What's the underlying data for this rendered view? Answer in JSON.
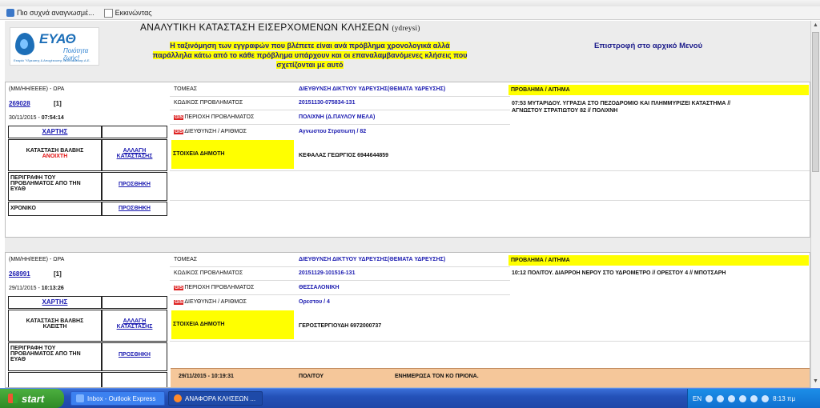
{
  "favorites": {
    "item1": "Πιο συχνά αναγνωσμέ...",
    "item2": "Εκκινώντας"
  },
  "header": {
    "logo_text": "ΕΥΑΘ",
    "logo_slogan": "Ποιότητα ζωής!",
    "logo_small": "Εταιρία Ύδρευσης & Αποχέτευσης Θεσσαλονίκης Α.Ε.",
    "title": "ΑΝΑΛΥΤΙΚΗ ΚΑΤΑΣΤΑΣΗ ΕΙΣΕΡΧΟΜΕΝΩΝ ΚΛΗΣΕΩΝ",
    "title_code": "(ydreysi)",
    "notice_line1": "Η ταξινόμηση των εγγραφών που βλέπετε είναι ανά πρόβλημα χρονολογικά αλλά",
    "notice_line2": "παράλληλα κάτω από το κάθε πρόβλημα υπάρχουν και οι επαναλαμβανόμενες κλήσεις που",
    "notice_line3": "σχετίζονται με αυτό",
    "back_link": "Επιστροφή στο αρχικό Μενού"
  },
  "labels": {
    "datetime": "(ΜΜ/ΗΗ/ΕΕΕΕ) - ΩΡΑ",
    "sector": "ΤΟΜΕΑΣ",
    "problem_code": "ΚΩΔΙΚΟΣ ΠΡΟΒΛΗΜΑΤΟΣ",
    "gis": "GIS",
    "area": "ΠΕΡΙΟΧΗ ΠΡΟΒΛΗΜΑΤΟΣ",
    "address": "ΔΙΕΥΘΥΝΣΗ / ΑΡΙΘΜΟΣ",
    "citizen": "ΣΤΟΙΧΕΙΑ ΔΗΜΟΤΗ",
    "problem_request": "ΠΡΟΒΛΗΜΑ / ΑΙΤΗΜΑ",
    "map": "ΧΑΡΤΗΣ",
    "valve_state": "ΚΑΤΑΣΤΑΣΗ ΒΑΛΒΗΣ",
    "change_state_1": "ΑΛΛΑΓΗ",
    "change_state_2": "ΚΑΤΑΣΤΑΣΗΣ",
    "description_1": "ΠΕΡΙΓΡΑΦΗ ΤΟΥ",
    "description_2": "ΠΡΟΒΛΗΜΑΤΟΣ ΑΠΟ ΤΗΝ",
    "description_3": "ΕΥΑΘ",
    "add": "ΠΡΟΣΘΗΚΗ",
    "chronicle": "ΧΡΟΝΙΚΟ"
  },
  "records": [
    {
      "id": "269028",
      "count": "[1]",
      "date": "30/11/2015 - ",
      "time": "07:54:14",
      "sector": "ΔΙΕΥΘΥΝΣΗ ΔΙΚΤΥΟΥ ΥΔΡΕΥΣΗΣ(ΘΕΜΑΤΑ ΥΔΡΕΥΣΗΣ)",
      "problem_code": "20151130-075834-131",
      "area": "ΠΟΛΙΧΝΗ (Δ.ΠΑΥΛΟΥ ΜΕΛΑ)",
      "address": "Αγνωστου Στρατιωτη / 82",
      "citizen": "ΚΕΦΑΛΑΣ ΓΕΩΡΓΙΟΣ 6944644859",
      "valve_state": "ΑΝΟΙΧΤΗ",
      "problem_text_1": "07:53 ΜΥΤΑΡΙΔΟΥ. ΥΓΡΑΣΙΑ ΣΤΟ ΠΕΖΟΔΡΟΜΙΟ ΚΑΙ ΠΛΗΜΜΥΡΙΖΕΙ ΚΑΤΑΣΤΗΜΑ //",
      "problem_text_2": "ΑΓΝΩΣΤΟΥ ΣΤΡΑΤΙΩΤΟΥ 82 // ΠΟΛΙΧΝΗ"
    },
    {
      "id": "268991",
      "count": "[1]",
      "date": "29/11/2015 - ",
      "time": "10:13:26",
      "sector": "ΔΙΕΥΘΥΝΣΗ ΔΙΚΤΥΟΥ ΥΔΡΕΥΣΗΣ(ΘΕΜΑΤΑ ΥΔΡΕΥΣΗΣ)",
      "problem_code": "20151129-101516-131",
      "area": "ΘΕΣΣΑΛΟΝΙΚΗ",
      "address": "Ορεστου / 4",
      "citizen": "ΓΕΡΟΣΤΕΡΓΙΟΥΔΗ 6972000737",
      "valve_state": "ΚΛΕΙΣΤΗ",
      "problem_text_1": "10:12 ΠΟΛΙΤΟΥ. ΔΙΑΡΡΟΗ ΝΕΡΟΥ ΣΤΟ ΥΔΡΟΜΕΤΡΟ // ΟΡΕΣΤΟΥ 4 // ΜΠΟΤΣΑΡΗ",
      "problem_text_2": "",
      "followup": {
        "datetime": "29/11/2015 - 10:19:31",
        "caller": "ΠΟΛΙΤΟΥ",
        "note": "ΕΝΗΜΕΡΩΣΑ ΤΟΝ ΚΟ ΠΡΙΟΝΑ."
      }
    }
  ],
  "taskbar": {
    "start": "start",
    "task1": "Inbox - Outlook Express",
    "task2": "ΑΝΑΦΟΡΑ ΚΛΗΣΕΩΝ ...",
    "lang": "EN",
    "clock": "8:13 πμ"
  }
}
